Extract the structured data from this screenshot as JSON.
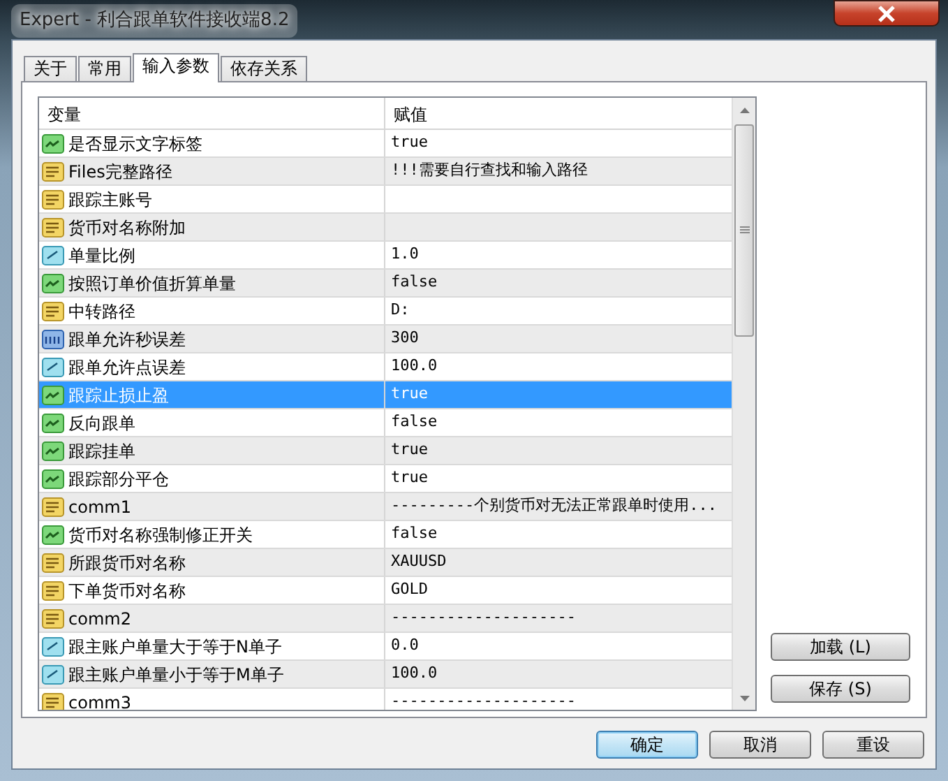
{
  "window": {
    "title": "Expert - 利合跟单软件接收端8.2"
  },
  "tabs": [
    {
      "label": "关于",
      "selected": false
    },
    {
      "label": "常用",
      "selected": false
    },
    {
      "label": "输入参数",
      "selected": true
    },
    {
      "label": "依存关系",
      "selected": false
    }
  ],
  "table": {
    "columns": [
      "变量",
      "赋值"
    ],
    "rows": [
      {
        "kind": "bool",
        "name": "是否显示文字标签",
        "value": "true",
        "selected": false
      },
      {
        "kind": "string",
        "name": "Files完整路径",
        "value": "!!!需要自行查找和输入路径",
        "selected": false
      },
      {
        "kind": "string",
        "name": "跟踪主账号",
        "selected": false
      },
      {
        "kind": "string",
        "name": "货币对名称附加",
        "selected": false
      },
      {
        "kind": "double",
        "name": "单量比例",
        "value": "1.0",
        "selected": false
      },
      {
        "kind": "bool",
        "name": "按照订单价值折算单量",
        "value": "false",
        "selected": false
      },
      {
        "kind": "string",
        "name": "中转路径",
        "value": "D:",
        "selected": false
      },
      {
        "kind": "int",
        "name": "跟单允许秒误差",
        "value": "300",
        "selected": false
      },
      {
        "kind": "double",
        "name": "跟单允许点误差",
        "value": "100.0",
        "selected": false
      },
      {
        "kind": "bool",
        "name": "跟踪止损止盈",
        "value": "true",
        "selected": true
      },
      {
        "kind": "bool",
        "name": "反向跟单",
        "value": "false",
        "selected": false
      },
      {
        "kind": "bool",
        "name": "跟踪挂单",
        "value": "true",
        "selected": false
      },
      {
        "kind": "bool",
        "name": "跟踪部分平仓",
        "value": "true",
        "selected": false
      },
      {
        "kind": "string",
        "name": "comm1",
        "value": "---------个别货币对无法正常跟单时使用...",
        "selected": false
      },
      {
        "kind": "bool",
        "name": "货币对名称强制修正开关",
        "value": "false",
        "selected": false
      },
      {
        "kind": "string",
        "name": "所跟货币对名称",
        "value": "XAUUSD",
        "selected": false
      },
      {
        "kind": "string",
        "name": "下单货币对名称",
        "value": "GOLD",
        "selected": false
      },
      {
        "kind": "string",
        "name": "comm2",
        "value": "--------------------",
        "selected": false
      },
      {
        "kind": "double",
        "name": "跟主账户单量大于等于N单子",
        "value": "0.0",
        "selected": false
      },
      {
        "kind": "double",
        "name": "跟主账户单量小于等于M单子",
        "value": "100.0",
        "selected": false
      },
      {
        "kind": "string",
        "name": "comm3",
        "value": "--------------------",
        "selected": false
      }
    ]
  },
  "side_buttons": [
    "加载 (L)",
    "保存 (S)"
  ],
  "buttons": [
    {
      "label": "确定",
      "default": true
    },
    {
      "label": "取消",
      "default": false
    },
    {
      "label": "重设",
      "default": false
    }
  ]
}
